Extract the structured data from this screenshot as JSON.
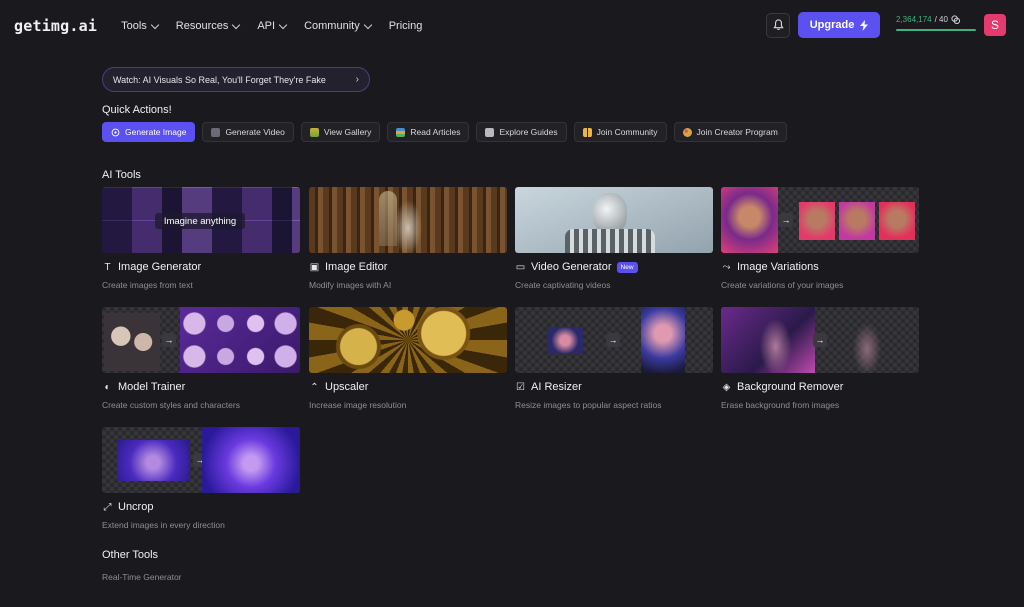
{
  "brand": {
    "logo": "getimg.ai"
  },
  "nav": [
    {
      "label": "Tools",
      "dropdown": true
    },
    {
      "label": "Resources",
      "dropdown": true
    },
    {
      "label": "API",
      "dropdown": true
    },
    {
      "label": "Community",
      "dropdown": true
    },
    {
      "label": "Pricing",
      "dropdown": false
    }
  ],
  "header": {
    "upgrade_label": "Upgrade",
    "credits_value": "2,364,174",
    "credits_total": "/ 40",
    "avatar_letter": "S"
  },
  "announcement": {
    "text": "Watch: AI Visuals So Real, You'll Forget They're Fake"
  },
  "quick_actions": {
    "title": "Quick Actions!",
    "items": [
      {
        "label": "Generate Image",
        "primary": true,
        "icon": "sparkle-icon"
      },
      {
        "label": "Generate Video",
        "primary": false,
        "icon": "video-icon"
      },
      {
        "label": "View Gallery",
        "primary": false,
        "icon": "gallery-icon"
      },
      {
        "label": "Read Articles",
        "primary": false,
        "icon": "book-icon"
      },
      {
        "label": "Explore Guides",
        "primary": false,
        "icon": "guide-icon"
      },
      {
        "label": "Join Community",
        "primary": false,
        "icon": "people-icon"
      },
      {
        "label": "Join Creator Program",
        "primary": false,
        "icon": "palette-icon"
      }
    ]
  },
  "ai_tools": {
    "title": "AI Tools",
    "items": [
      {
        "name": "Image Generator",
        "desc": "Create images from text",
        "icon": "text-icon",
        "overlay": "Imagine anything"
      },
      {
        "name": "Image Editor",
        "desc": "Modify images with AI",
        "icon": "image-edit-icon"
      },
      {
        "name": "Video Generator",
        "desc": "Create captivating videos",
        "icon": "video-camera-icon",
        "badge": "New"
      },
      {
        "name": "Image Variations",
        "desc": "Create variations of your images",
        "icon": "variations-icon"
      },
      {
        "name": "Model Trainer",
        "desc": "Create custom styles and characters",
        "icon": "model-trainer-icon"
      },
      {
        "name": "Upscaler",
        "desc": "Increase image resolution",
        "icon": "upscale-icon"
      },
      {
        "name": "AI Resizer",
        "desc": "Resize images to popular aspect ratios",
        "icon": "resize-icon"
      },
      {
        "name": "Background Remover",
        "desc": "Erase background from images",
        "icon": "layers-icon"
      },
      {
        "name": "Uncrop",
        "desc": "Extend images in every direction",
        "icon": "expand-icon"
      }
    ]
  },
  "other_tools": {
    "title": "Other Tools",
    "items": [
      {
        "label": "Real-Time Generator"
      }
    ]
  }
}
